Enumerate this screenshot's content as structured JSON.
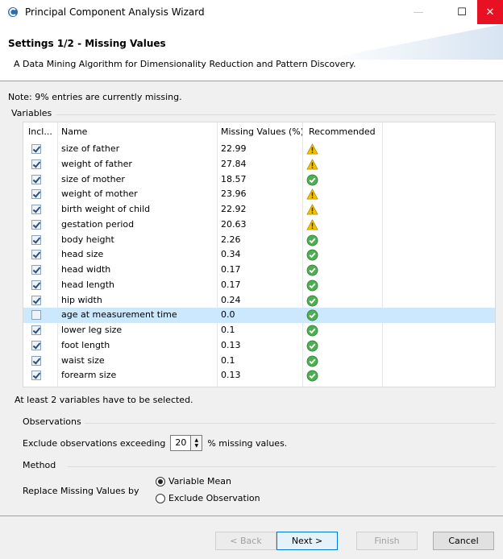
{
  "window": {
    "title": "Principal Component Analysis Wizard",
    "minimize_glyph": "—",
    "maximize_glyph": "☐",
    "close_glyph": "✕"
  },
  "header": {
    "title": "Settings 1/2 - Missing Values",
    "description": "A Data Mining Algorithm for Dimensionality Reduction and Pattern Discovery."
  },
  "note": "Note: 9% entries are currently missing.",
  "variables": {
    "group_title": "Variables",
    "columns": {
      "incl": "Incl...",
      "name": "Name",
      "missing": "Missing Values (%)",
      "recommended": "Recommended"
    },
    "rows": [
      {
        "included": true,
        "name": "size of father",
        "missing": "22.99",
        "recommended": "warning"
      },
      {
        "included": true,
        "name": "weight of father",
        "missing": "27.84",
        "recommended": "warning"
      },
      {
        "included": true,
        "name": "size of mother",
        "missing": "18.57",
        "recommended": "ok"
      },
      {
        "included": true,
        "name": "weight of mother",
        "missing": "23.96",
        "recommended": "warning"
      },
      {
        "included": true,
        "name": "birth weight of child",
        "missing": "22.92",
        "recommended": "warning"
      },
      {
        "included": true,
        "name": "gestation period",
        "missing": "20.63",
        "recommended": "warning"
      },
      {
        "included": true,
        "name": "body height",
        "missing": "2.26",
        "recommended": "ok"
      },
      {
        "included": true,
        "name": "head size",
        "missing": "0.34",
        "recommended": "ok"
      },
      {
        "included": true,
        "name": "head width",
        "missing": "0.17",
        "recommended": "ok"
      },
      {
        "included": true,
        "name": "head length",
        "missing": "0.17",
        "recommended": "ok"
      },
      {
        "included": true,
        "name": "hip width",
        "missing": "0.24",
        "recommended": "ok"
      },
      {
        "included": false,
        "name": "age at measurement time",
        "missing": "0.0",
        "recommended": "ok",
        "selected": true
      },
      {
        "included": true,
        "name": "lower leg size",
        "missing": "0.1",
        "recommended": "ok"
      },
      {
        "included": true,
        "name": "foot length",
        "missing": "0.13",
        "recommended": "ok"
      },
      {
        "included": true,
        "name": "waist size",
        "missing": "0.1",
        "recommended": "ok"
      },
      {
        "included": true,
        "name": "forearm size",
        "missing": "0.13",
        "recommended": "ok"
      }
    ],
    "hint": "At least 2 variables have to be selected."
  },
  "observations": {
    "group_title": "Observations",
    "prefix": "Exclude observations exceeding",
    "value": "20",
    "suffix": "% missing values."
  },
  "method": {
    "group_title": "Method",
    "label": "Replace Missing Values by",
    "options": [
      {
        "label": "Variable Mean",
        "selected": true
      },
      {
        "label": "Exclude Observation",
        "selected": false
      }
    ]
  },
  "buttons": {
    "back": "< Back",
    "next": "Next >",
    "finish": "Finish",
    "cancel": "Cancel"
  },
  "colors": {
    "warning": "#f2c200",
    "ok": "#4caf50",
    "close": "#e81123",
    "selection": "#cce8ff"
  }
}
